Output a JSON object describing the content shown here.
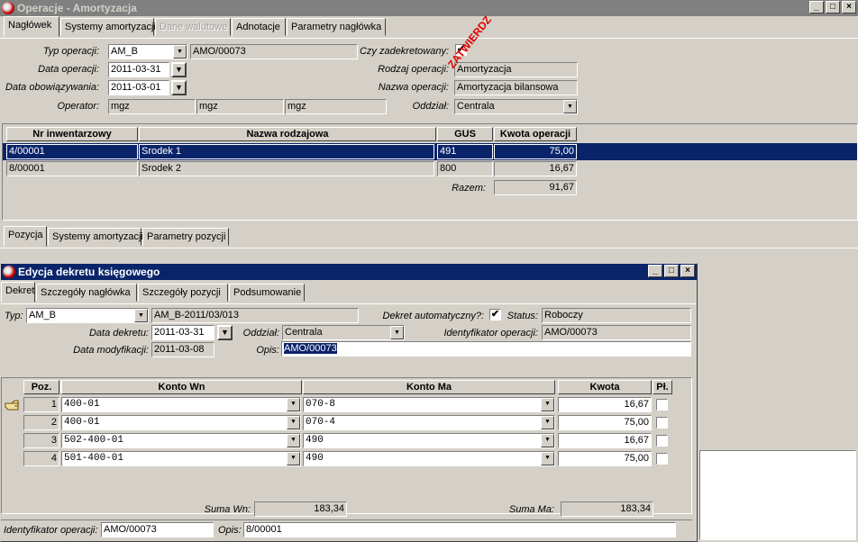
{
  "main_window": {
    "title": "Operacje - Amortyzacja",
    "tabs": [
      "Nagłówek",
      "Systemy amortyzacji",
      "Dane walutowe",
      "Adnotacje",
      "Parametry nagłówka"
    ],
    "fields": {
      "typ_label": "Typ operacji:",
      "typ_value": "AM_B",
      "typ_number": "AMO/00073",
      "data_operacji_label": "Data operacji:",
      "data_operacji_value": "2011-03-31",
      "data_obow_label": "Data obowiązywania:",
      "data_obow_value": "2011-03-01",
      "operator_label": "Operator:",
      "operator1": "mgz",
      "operator2": "mgz",
      "operator3": "mgz",
      "zadekretowany_label": "Czy zadekretowany:",
      "zadekretowany_check": "✔",
      "rodzaj_label": "Rodzaj operacji:",
      "rodzaj_value": "Amortyzacja",
      "nazwa_label": "Nazwa operacji:",
      "nazwa_value": "Amortyzacja bilansowa",
      "oddzial_label": "Oddział:",
      "oddzial_value": "Centrala",
      "stamp": "ZATWIERDZ"
    },
    "table": {
      "headers": [
        "Nr inwentarzowy",
        "Nazwa rodzajowa",
        "GUS",
        "Kwota operacji"
      ],
      "rows": [
        {
          "nr": "4/00001",
          "nazwa": "Srodek 1",
          "gus": "491",
          "kwota": "75,00"
        },
        {
          "nr": "8/00001",
          "nazwa": "Srodek 2",
          "gus": "800",
          "kwota": "16,67"
        }
      ],
      "razem_label": "Razem:",
      "razem_value": "91,67"
    },
    "position_tabs": [
      "Pozycja",
      "Systemy amortyzacji",
      "Parametry pozycji"
    ]
  },
  "dialog": {
    "title": "Edycja dekretu księgowego",
    "tabs": [
      "Dekret",
      "Szczegóły nagłówka",
      "Szczegóły pozycji",
      "Podsumowanie"
    ],
    "fields": {
      "typ_label": "Typ:",
      "typ_value": "AM_B",
      "typ_number": "AM_B-2011/03/013",
      "data_dekretu_label": "Data dekretu:",
      "data_dekretu_value": "2011-03-31",
      "data_mod_label": "Data modyfikacji:",
      "data_mod_value": "2011-03-08",
      "oddzial_label": "Oddział:",
      "oddzial_value": "Centrala",
      "opis_label": "Opis:",
      "opis_value": "AMO/00073",
      "dekret_auto_label": "Dekret automatyczny?:",
      "dekret_auto_check": "✔",
      "status_label": "Status:",
      "status_value": "Roboczy",
      "ident_label": "Identyfikator operacji:",
      "ident_value": "AMO/00073"
    },
    "grid": {
      "headers": [
        "Poz.",
        "*",
        "Konto Wn",
        "Konto Ma",
        "Kwota",
        "Pł."
      ],
      "rows": [
        {
          "poz": "1",
          "wn": "400-01",
          "ma": "070-8",
          "kwota": "16,67"
        },
        {
          "poz": "2",
          "wn": "400-01",
          "ma": "070-4",
          "kwota": "75,00"
        },
        {
          "poz": "3",
          "wn": "502-400-01",
          "ma": "490",
          "kwota": "16,67"
        },
        {
          "poz": "4",
          "wn": "501-400-01",
          "ma": "490",
          "kwota": "75,00"
        }
      ]
    },
    "suma_wn_label": "Suma Wn:",
    "suma_wn_value": "183,34",
    "suma_ma_label": "Suma Ma:",
    "suma_ma_value": "183,34",
    "footer": {
      "ident_label": "Identyfikator operacji:",
      "ident_value": "AMO/00073",
      "opis_label": "Opis:",
      "opis_value": "8/00001"
    }
  }
}
